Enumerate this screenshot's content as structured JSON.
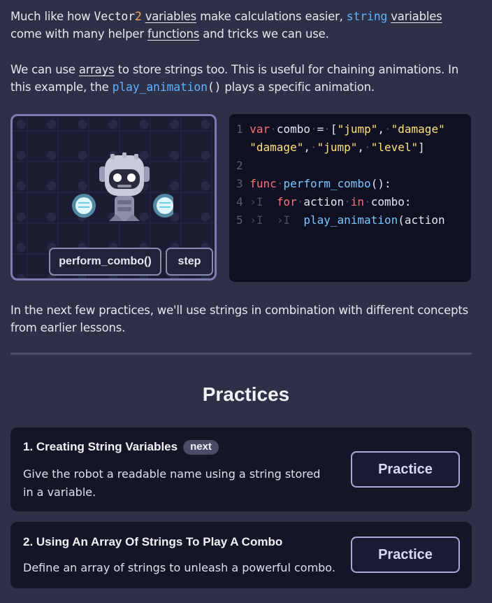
{
  "intro": {
    "p1_a": "Much like how ",
    "p1_code_vector": "Vector",
    "p1_code_2": "2",
    "p1_link_variables": "variables",
    "p1_b": " make calculations easier, ",
    "p1_code_string": "string",
    "p1_link_variables2": "variables",
    "p1_c": "come with many helper ",
    "p1_link_functions": "functions",
    "p1_d": " and tricks we can use.",
    "p2_a": "We can use ",
    "p2_link_arrays": "arrays",
    "p2_b": " to store strings too. This is useful for chaining animations. In",
    "p2_c": "this example, the ",
    "p2_code": "play_animation",
    "p2_code_paren": "()",
    "p2_d": " plays a specific animation."
  },
  "demo": {
    "perform_button": "perform_combo()",
    "step_button": "step"
  },
  "code": {
    "l1_num": "1",
    "l1_var": "var",
    "l1_name": "combo",
    "l1_eq": "=",
    "l1_open": "[",
    "l1_s1": "\"jump\"",
    "l1_comma": ",",
    "l1_s2": "\"damage\"",
    "l1b_s3": "\"damage\"",
    "l1b_s4": "\"jump\"",
    "l1b_s5": "\"level\"",
    "l1b_close": "]",
    "l2_num": "2",
    "l3_num": "3",
    "l3_func": "func",
    "l3_name": "perform_combo",
    "l3_tail": "():",
    "l4_num": "4",
    "l4_for": "for",
    "l4_action": "action",
    "l4_in": "in",
    "l4_combo": "combo:",
    "l5_num": "5",
    "l5_call": "play_animation",
    "l5_tail": "(action"
  },
  "outro": {
    "p3_line1": "In the next few practices, we'll use strings in combination with different concepts",
    "p3_line2": "from earlier lessons."
  },
  "practices": {
    "heading": "Practices",
    "items": [
      {
        "title": "1. Creating String Variables",
        "badge": "next",
        "desc": "Give the robot a readable name using a string stored in a variable.",
        "button": "Practice"
      },
      {
        "title": "2. Using An Array Of Strings To Play A Combo",
        "desc": "Define an array of strings to unleash a powerful combo.",
        "button": "Practice"
      }
    ]
  }
}
